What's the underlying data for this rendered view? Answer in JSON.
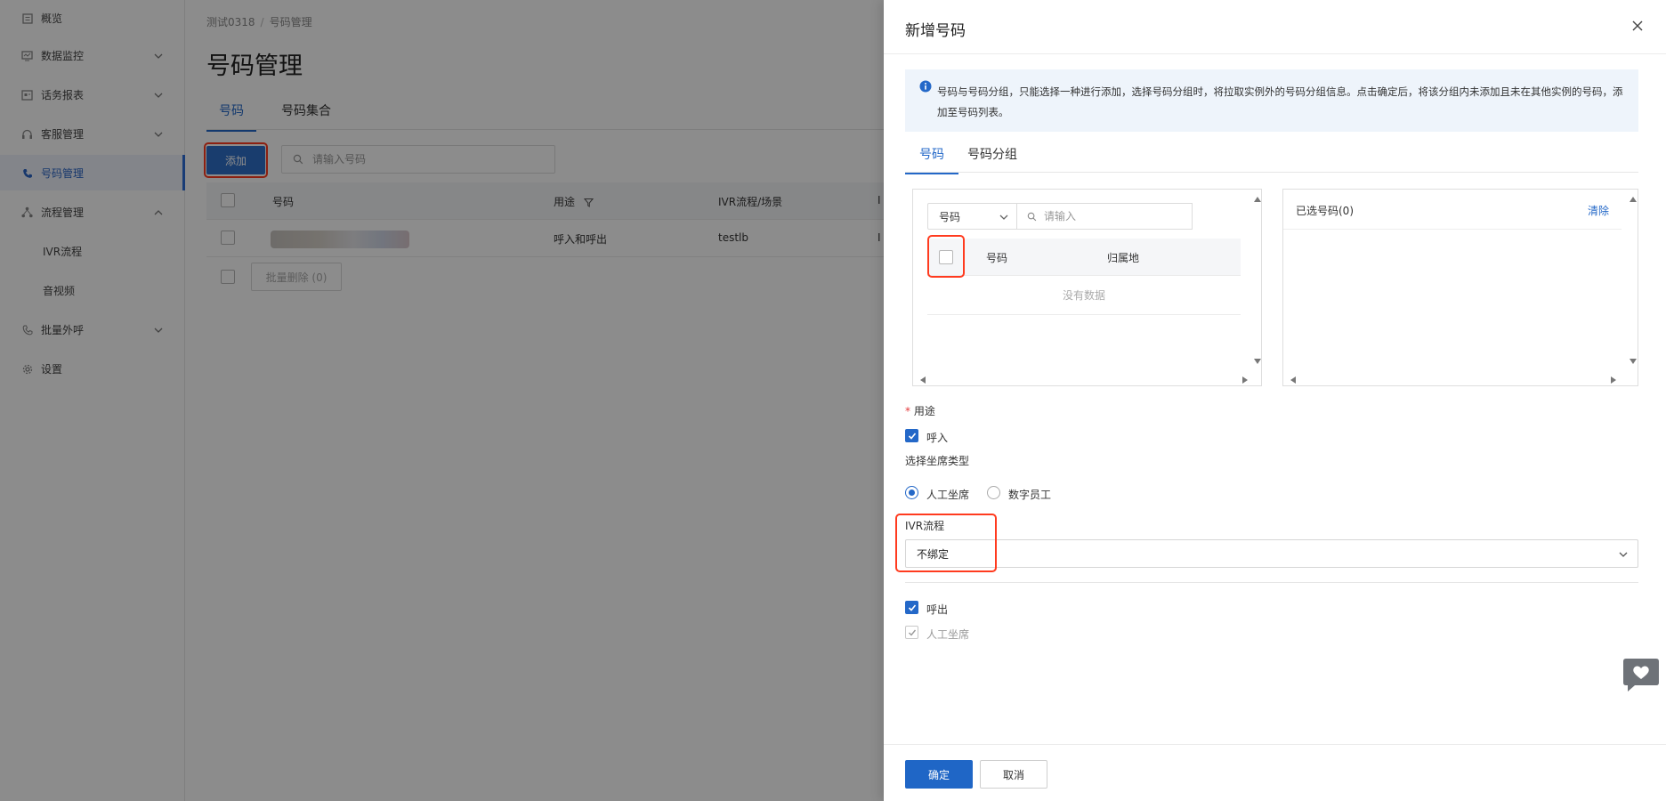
{
  "sidebar": {
    "items": [
      {
        "label": "概览",
        "icon": "overview-icon"
      },
      {
        "label": "数据监控",
        "icon": "monitor-icon"
      },
      {
        "label": "话务报表",
        "icon": "report-icon"
      },
      {
        "label": "客服管理",
        "icon": "headset-icon"
      },
      {
        "label": "号码管理",
        "icon": "phone-icon"
      },
      {
        "label": "流程管理",
        "icon": "flow-icon"
      },
      {
        "label": "IVR流程"
      },
      {
        "label": "音视频"
      },
      {
        "label": "批量外呼",
        "icon": "phone-icon"
      },
      {
        "label": "设置",
        "icon": "gear-icon"
      }
    ]
  },
  "breadcrumb": {
    "root": "测试0318",
    "sep": "/",
    "current": "号码管理"
  },
  "page": {
    "title": "号码管理",
    "tabs": [
      "号码",
      "号码集合"
    ],
    "add_label": "添加",
    "search_placeholder": "请输入号码",
    "table": {
      "headers": [
        "号码",
        "用途",
        "IVR流程/场景",
        "I"
      ],
      "rows": [
        {
          "purpose": "呼入和呼出",
          "ivr": "testlb",
          "extra": "I"
        }
      ]
    },
    "batch_delete_label": "批量删除 (0)"
  },
  "drawer": {
    "title": "新增号码",
    "alert_text": "号码与号码分组，只能选择一种进行添加，选择号码分组时，将拉取实例外的号码分组信息。点击确定后，将该分组内未添加且未在其他实例的号码，添加至号码列表。",
    "tabs": [
      "号码",
      "号码分组"
    ],
    "left_panel": {
      "type_select": "号码",
      "search_placeholder": "请输入",
      "headers": [
        "号码",
        "归属地"
      ],
      "empty_text": "没有数据"
    },
    "right_panel": {
      "title": "已选号码(0)",
      "clear_label": "清除"
    },
    "purpose_required": "*",
    "purpose_label": "用途",
    "inbound_label": "呼入",
    "seat_type_label": "选择坐席类型",
    "seat_types": [
      "人工坐席",
      "数字员工"
    ],
    "ivr_label": "IVR流程",
    "ivr_value": "不绑定",
    "outbound_label": "呼出",
    "outbound_seat_label": "人工坐席",
    "ok_label": "确定",
    "cancel_label": "取消"
  },
  "colors": {
    "primary": "#2468c8",
    "highlight": "#ff3b1f"
  }
}
